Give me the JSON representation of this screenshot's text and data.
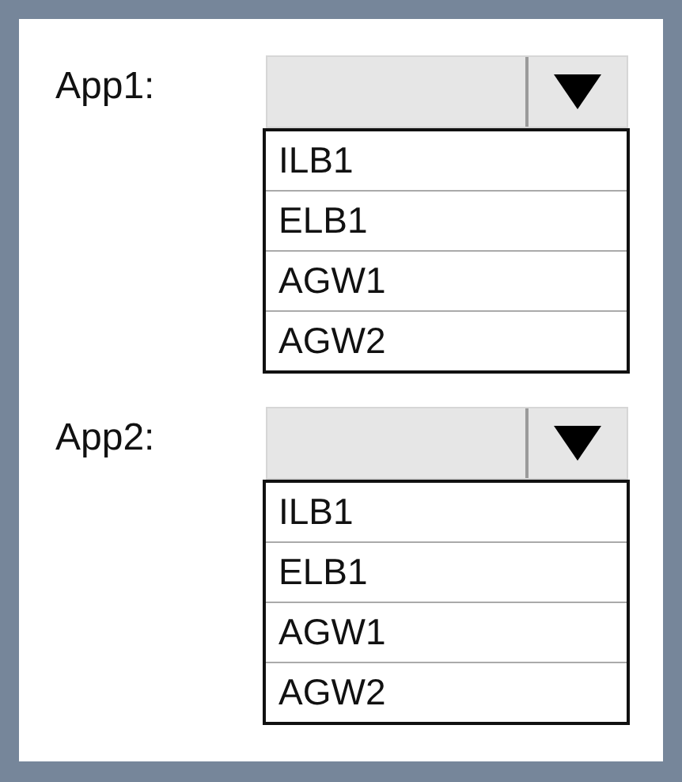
{
  "questions": [
    {
      "label": "App1:",
      "options": [
        "ILB1",
        "ELB1",
        "AGW1",
        "AGW2"
      ]
    },
    {
      "label": "App2:",
      "options": [
        "ILB1",
        "ELB1",
        "AGW1",
        "AGW2"
      ]
    }
  ]
}
